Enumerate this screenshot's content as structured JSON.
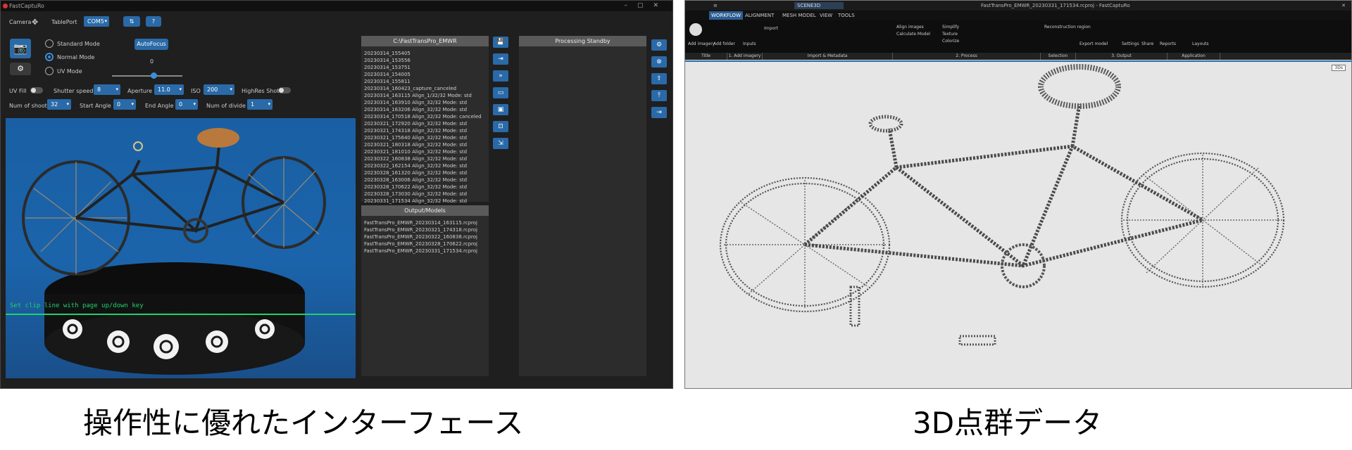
{
  "left_app": {
    "title": "FastCaptuRo",
    "window_controls": [
      "–",
      "▢",
      "✕"
    ],
    "toolbar": {
      "camera_label": "Camera",
      "table_port_label": "TablePort",
      "table_port_value": "COM5"
    },
    "modes": {
      "standard": "Standard Mode",
      "normal": "Normal Mode",
      "uv": "UV Mode",
      "selected": "normal"
    },
    "autofocus_label": "AutoFocus",
    "focus_value": "0",
    "settings_row1": {
      "uv_fill_label": "UV Fill",
      "shutter_speed_label": "Shutter speed",
      "shutter_speed_value": "8",
      "aperture_label": "Aperture",
      "aperture_value": "11.0",
      "iso_label": "ISO",
      "iso_value": "200",
      "highres_label": "HighRes Shot"
    },
    "settings_row2": {
      "num_shoot_label": "Num of shoot",
      "num_shoot_value": "32",
      "start_angle_label": "Start Angle",
      "start_angle_value": "0",
      "end_angle_label": "End Angle",
      "end_angle_value": "0",
      "num_divide_label": "Num of divide",
      "num_divide_value": "1"
    },
    "clip_hint": "Set clip line with page up/down key",
    "project_panel": {
      "title": "C:\\FastTransPro_EMWR",
      "items": [
        "20230314_155405",
        "20230314_153556",
        "20230314_153751",
        "20230314_154005",
        "20230314_155811",
        "20230314_160423_capture_canceled",
        "20230314_163115 Align_1/32/32 Mode: std",
        "20230314_163910 Align_32/32 Mode: std",
        "20230314_163206 Align_32/32 Mode: std",
        "20230314_170518 Align_32/32 Mode: canceled",
        "20230321_172920 Align_32/32 Mode: std",
        "20230321_174318 Align_32/32 Mode: std",
        "20230321_175640 Align_32/32 Mode: std",
        "20230321_180318 Align_32/32 Mode: std",
        "20230321_181010 Align_32/32 Mode: std",
        "20230322_160838 Align_32/32 Mode: std",
        "20230322_162154 Align_32/32 Mode: std",
        "20230328_161320 Align_32/32 Mode: std",
        "20230328_163006 Align_32/32 Mode: std",
        "20230328_170622 Align_32/32 Mode: std",
        "20230328_173030 Align_32/32 Mode: std",
        "20230331_171534 Align_32/32 Mode: std"
      ]
    },
    "output_panel": {
      "title": "Output/Models",
      "items": [
        "FastTransPro_EMWR_20230314_163115.rcproj",
        "FastTransPro_EMWR_20230321_174318.rcproj",
        "FastTransPro_EMWR_20230322_160838.rcproj",
        "FastTransPro_EMWR_20230328_170622.rcproj",
        "FastTransPro_EMWR_20230331_171534.rcproj"
      ]
    },
    "process_panel": {
      "title": "Processing Standby"
    }
  },
  "right_app": {
    "quick_bar": "≡",
    "search_value": "SCENE3D",
    "title": "FastTransPro_EMWR_20230331_171534.rcproj - FastCaptuRo",
    "tabs": [
      "WORKFLOW",
      "ALIGNMENT",
      "MESH MODEL",
      "VIEW",
      "TOOLS"
    ],
    "active_tab": "WORKFLOW",
    "ribbon_items": [
      "Add imagery",
      "Add folder",
      "Inputs",
      "Import",
      "Align images",
      "Calculate Model",
      "Simplify",
      "Texture",
      "Colorize",
      "Reconstruction region",
      "Export model",
      "Settings",
      "Share",
      "Reports",
      "Layouts"
    ],
    "groups": [
      "Title",
      "1. Add imagery",
      "Import & Metadata",
      "2. Process",
      "Selection",
      "3. Output",
      "Application"
    ],
    "view_badge": "3Ds",
    "caption": "3D点群データ"
  },
  "captions": {
    "left": "操作性に優れたインターフェース",
    "right": "3D点群データ"
  },
  "colors": {
    "accent_blue": "#2a6aa8",
    "clip_green": "#1fd16a",
    "ribbon_active": "#2d5e93"
  }
}
